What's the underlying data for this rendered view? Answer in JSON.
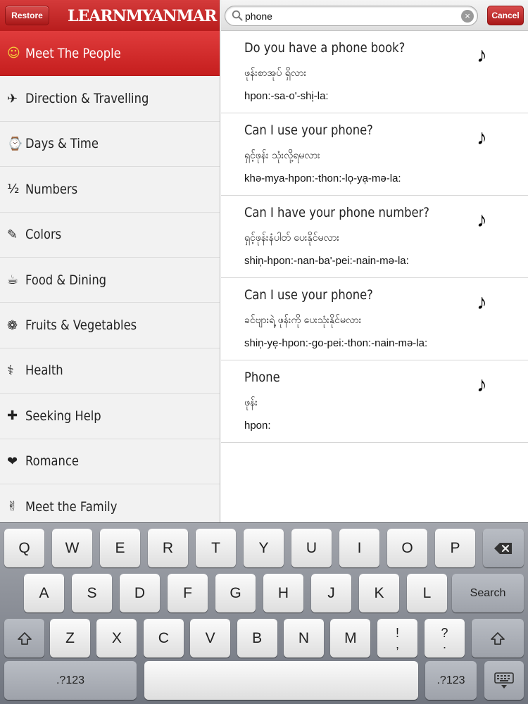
{
  "sidebar": {
    "restore_label": "Restore",
    "logo_text": "LEARNMYANMAR",
    "items": [
      {
        "icon": "☺",
        "label": "Meet The People",
        "selected": true
      },
      {
        "icon": "✈",
        "label": "Direction & Travelling"
      },
      {
        "icon": "⌚",
        "label": "Days & Time"
      },
      {
        "icon": "½",
        "label": "Numbers"
      },
      {
        "icon": "✎",
        "label": "Colors"
      },
      {
        "icon": "☕",
        "label": "Food & Dining"
      },
      {
        "icon": "❁",
        "label": "Fruits & Vegetables"
      },
      {
        "icon": "⚕",
        "label": "Health"
      },
      {
        "icon": "✚",
        "label": "Seeking Help"
      },
      {
        "icon": "❤",
        "label": "Romance"
      },
      {
        "icon": "✌",
        "label": "Meet the Family"
      }
    ]
  },
  "search": {
    "value": "phone",
    "clear_icon": "×",
    "cancel_label": "Cancel"
  },
  "results": [
    {
      "english": "Do you have a phone book?",
      "myanmar": "ဖုန်းစာအုပ် ရှိလား",
      "roman": "hpon:-sa-o'-shi̩-la:",
      "audio_icon": "♪"
    },
    {
      "english": "Can I use your phone?",
      "myanmar": "ရှင့်ဖုန်း သုံးလို့ရမလား",
      "roman": "khə-mya-hpon:-thon:-lo̩-ya̩-mə-la:",
      "audio_icon": "♪"
    },
    {
      "english": "Can I have your phone number?",
      "myanmar": "ရှင့်ဖုန်းနံပါတ် ပေးနိုင်မလား",
      "roman": "shin̩-hpon:-nan-ba'-pei:-nain-mə-la:",
      "audio_icon": "♪"
    },
    {
      "english": "Can I use your phone?",
      "myanmar": "ခင်ဗျားရဲ့ ဖုန်းကို ပေးသုံးနိုင်မလား",
      "roman": "shin̩-ye̩-hpon:-go-pei:-thon:-nain-mə-la:",
      "audio_icon": "♪"
    },
    {
      "english": "Phone",
      "myanmar": "ဖုန်း",
      "roman": "hpon:",
      "audio_icon": "♪"
    }
  ],
  "keyboard": {
    "row1": [
      "Q",
      "W",
      "E",
      "R",
      "T",
      "Y",
      "U",
      "I",
      "O",
      "P"
    ],
    "row2": [
      "A",
      "S",
      "D",
      "F",
      "G",
      "H",
      "J",
      "K",
      "L"
    ],
    "row3": [
      "Z",
      "X",
      "C",
      "V",
      "B",
      "N",
      "M"
    ],
    "search_label": "Search",
    "numbers_label": ".?123",
    "exclaim_top": "!",
    "exclaim_bottom": ",",
    "question_top": "?",
    "question_bottom": "."
  }
}
